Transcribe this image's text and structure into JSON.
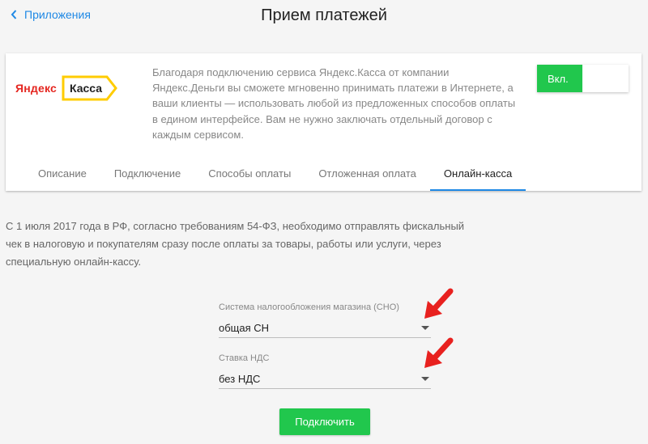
{
  "header": {
    "back_label": "Приложения",
    "title": "Прием платежей"
  },
  "card": {
    "logo": {
      "brand": "Яндекс",
      "product": "Касса"
    },
    "description": "Благодаря подключению сервиса Яндекс.Касса от компании Яндекс.Деньги вы сможете мгновенно принимать платежи в Интернете, а ваши клиенты — использовать любой из предложенных способов оплаты в едином интерфейсе. Вам не нужно заключать отдельный договор с каждым сервисом.",
    "toggle": {
      "on_label": "Вкл.",
      "state": "on"
    },
    "tabs": [
      {
        "label": "Описание"
      },
      {
        "label": "Подключение"
      },
      {
        "label": "Способы оплаты"
      },
      {
        "label": "Отложенная оплата"
      },
      {
        "label": "Онлайн-касса"
      }
    ],
    "active_tab": "Онлайн-касса"
  },
  "info_text": "С 1 июля 2017 года в РФ, согласно требованиям 54-ФЗ, необходимо отправлять фискальный чек в налоговую и покупателям сразу после оплаты за товары, работы или услуги, через специальную онлайн-кассу.",
  "form": {
    "tax_system": {
      "label": "Система налогообложения магазина (СНО)",
      "value": "общая СН"
    },
    "vat_rate": {
      "label": "Ставка НДС",
      "value": "без НДС"
    },
    "submit_label": "Подключить"
  },
  "colors": {
    "accent_blue": "#1e88e5",
    "green": "#21c74d",
    "annotation_red": "#e8211f",
    "logo_red": "#e52620",
    "logo_yellow": "#ffcc00"
  },
  "icons": {
    "back": "chevron-left-icon",
    "dropdown": "caret-down-icon",
    "annotation": "red-arrow-annotation"
  }
}
